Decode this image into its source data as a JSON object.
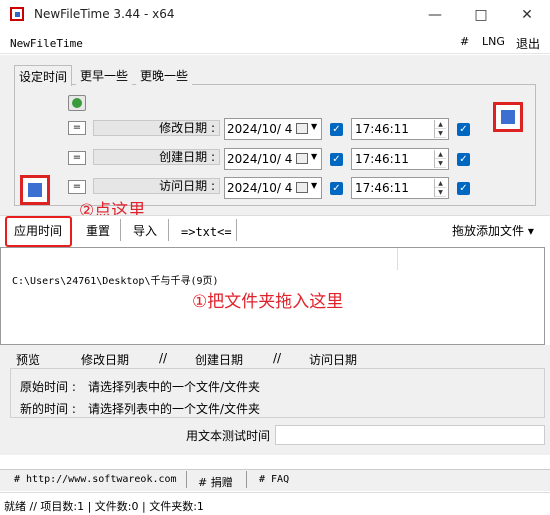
{
  "window": {
    "title": "NewFileTime 3.44 - x64"
  },
  "menubar": {
    "app_name": "NewFileTime",
    "hash": "#",
    "lng": "LNG",
    "exit": "退出"
  },
  "tabs": [
    "设定时间",
    "更早一些",
    "更晚一些"
  ],
  "rows": [
    {
      "eq": "=",
      "label": "修改日期 :",
      "date": "2024/10/ 4",
      "time": "17:46:11"
    },
    {
      "eq": "=",
      "label": "创建日期 :",
      "date": "2024/10/ 4",
      "time": "17:46:11"
    },
    {
      "eq": "=",
      "label": "访问日期 :",
      "date": "2024/10/ 4",
      "time": "17:46:11"
    }
  ],
  "toolbar": {
    "apply": "应用时间",
    "reset": "重置",
    "import": "导入",
    "txt": "=>txt<=",
    "drag_add": "拖放添加文件 ▾"
  },
  "annotations": {
    "step2": "②点这里",
    "step1": "①把文件夹拖入这里"
  },
  "filelist": {
    "path": "C:\\Users\\24761\\Desktop\\千与千寻(9页)"
  },
  "preview": {
    "header": [
      "预览",
      "修改日期",
      "//",
      "创建日期",
      "//",
      "访问日期"
    ],
    "original_label": "原始时间 :",
    "original_value": "请选择列表中的一个文件/文件夹",
    "new_label": "新的时间 :",
    "new_value": "请选择列表中的一个文件/文件夹",
    "test_label": "用文本测试时间"
  },
  "links": {
    "website": "# http://www.softwareok.com",
    "donate": "# 捐赠",
    "faq": "# FAQ"
  },
  "status": {
    "text": "就绪 // 项目数:1 | 文件数:0  | 文件夹数:1"
  },
  "colors": {
    "accent": "#0067c0",
    "annotation": "#e0212c"
  }
}
